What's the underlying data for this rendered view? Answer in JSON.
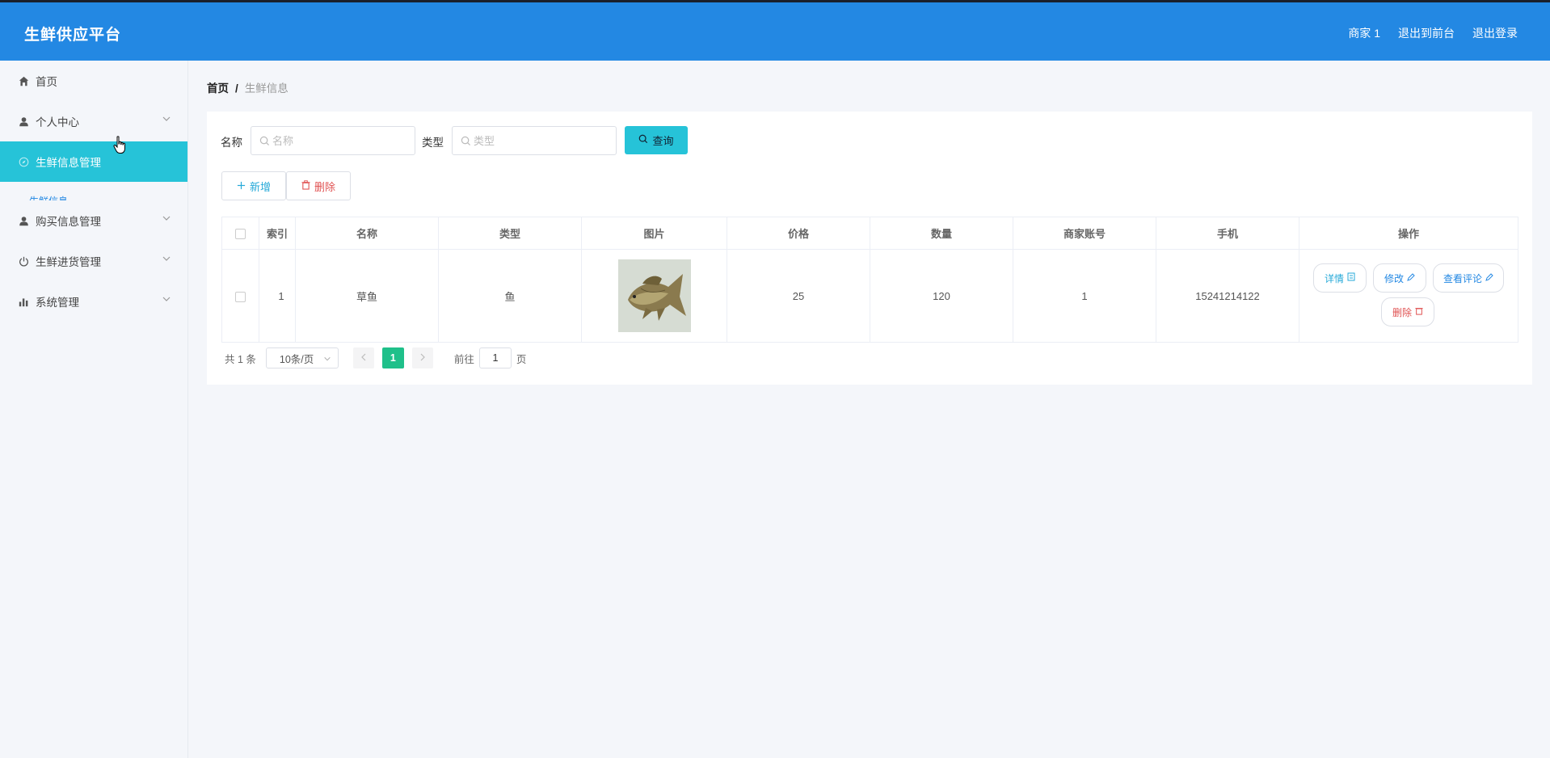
{
  "header": {
    "brand": "生鲜供应平台",
    "user": "商家 1",
    "back_front": "退出到前台",
    "logout": "退出登录"
  },
  "sidebar": {
    "items": [
      {
        "label": "首页",
        "icon": "home-icon"
      },
      {
        "label": "个人中心",
        "icon": "user-icon"
      },
      {
        "label": "生鲜信息管理",
        "icon": "compass-icon"
      },
      {
        "label": "购买信息管理",
        "icon": "user-icon"
      },
      {
        "label": "生鲜进货管理",
        "icon": "power-icon"
      },
      {
        "label": "系统管理",
        "icon": "bar-chart-icon"
      }
    ],
    "submenu_peek": "生鲜信息"
  },
  "breadcrumb": {
    "home": "首页",
    "sep": "/",
    "current": "生鲜信息"
  },
  "search": {
    "name_label": "名称",
    "name_placeholder": "名称",
    "type_label": "类型",
    "type_placeholder": "类型",
    "query_label": "查询"
  },
  "actions": {
    "add_label": "新增",
    "delete_label": "删除"
  },
  "table": {
    "columns": [
      "索引",
      "名称",
      "类型",
      "图片",
      "价格",
      "数量",
      "商家账号",
      "手机",
      "操作"
    ],
    "rows": [
      {
        "index": "1",
        "name": "草鱼",
        "type": "鱼",
        "price": "25",
        "quantity": "120",
        "merchant": "1",
        "phone": "15241214122",
        "ops": {
          "detail": "详情",
          "edit": "修改",
          "review": "查看评论",
          "delete": "删除"
        }
      }
    ]
  },
  "pager": {
    "total": "共 1 条",
    "page_size": "10条/页",
    "current_page": "1",
    "goto_prefix": "前往",
    "goto_value": "1",
    "goto_suffix": "页"
  },
  "colors": {
    "header": "#2388e3",
    "active_menu": "#26c3d8",
    "page_active": "#1fc08a",
    "danger": "#e05252"
  }
}
